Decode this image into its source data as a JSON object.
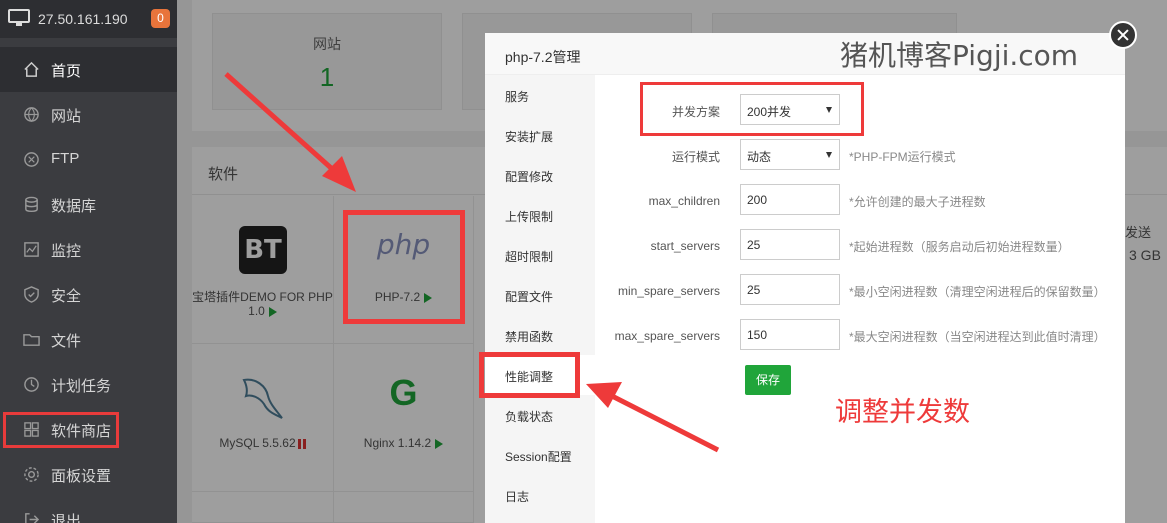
{
  "sidebar": {
    "server_ip": "27.50.161.190",
    "badge_count": "0",
    "items": [
      {
        "label": "首页",
        "icon": "home-icon"
      },
      {
        "label": "网站",
        "icon": "globe-icon"
      },
      {
        "label": "FTP",
        "icon": "ftp-icon"
      },
      {
        "label": "数据库",
        "icon": "database-icon"
      },
      {
        "label": "监控",
        "icon": "monitor-icon"
      },
      {
        "label": "安全",
        "icon": "shield-icon"
      },
      {
        "label": "文件",
        "icon": "folder-icon"
      },
      {
        "label": "计划任务",
        "icon": "clock-icon"
      },
      {
        "label": "软件商店",
        "icon": "grid-icon"
      },
      {
        "label": "面板设置",
        "icon": "gear-icon"
      },
      {
        "label": "退出",
        "icon": "logout-icon"
      }
    ]
  },
  "dashboard": {
    "stat_website_label": "网站",
    "stat_website_value": "1"
  },
  "software": {
    "header": "软件",
    "apps": [
      {
        "name": "宝塔插件DEMO FOR PHP",
        "version": "1.0",
        "status": "running"
      },
      {
        "name": "PHP-7.2",
        "status": "running"
      },
      {
        "name": "MySQL 5.5.62",
        "status": "paused"
      },
      {
        "name": "Nginx 1.14.2",
        "status": "running"
      }
    ],
    "right_fragments": [
      "发送",
      "3 GB"
    ]
  },
  "modal": {
    "title": "php-7.2管理",
    "watermark": "猪机博客Pigji.com",
    "tabs": [
      "服务",
      "安装扩展",
      "配置修改",
      "上传限制",
      "超时限制",
      "配置文件",
      "禁用函数",
      "性能调整",
      "负载状态",
      "Session配置",
      "日志"
    ],
    "active_tab": "性能调整",
    "form": {
      "concurrency_label": "并发方案",
      "concurrency_value": "200并发",
      "run_mode_label": "运行模式",
      "run_mode_value": "动态",
      "run_mode_hint": "*PHP-FPM运行模式",
      "max_children_label": "max_children",
      "max_children_value": "200",
      "max_children_hint": "*允许创建的最大子进程数",
      "start_servers_label": "start_servers",
      "start_servers_value": "25",
      "start_servers_hint": "*起始进程数（服务启动后初始进程数量）",
      "min_spare_label": "min_spare_servers",
      "min_spare_value": "25",
      "min_spare_hint": "*最小空闲进程数（清理空闲进程后的保留数量）",
      "max_spare_label": "max_spare_servers",
      "max_spare_value": "150",
      "max_spare_hint": "*最大空闲进程数（当空闲进程达到此值时清理）",
      "save_label": "保存"
    }
  },
  "annotation": {
    "text": "调整并发数",
    "color": "#ee3a3a"
  },
  "colors": {
    "sidebar_bg": "#3b3c40",
    "accent_green": "#20a53a",
    "highlight_red": "#ee3a3a"
  }
}
